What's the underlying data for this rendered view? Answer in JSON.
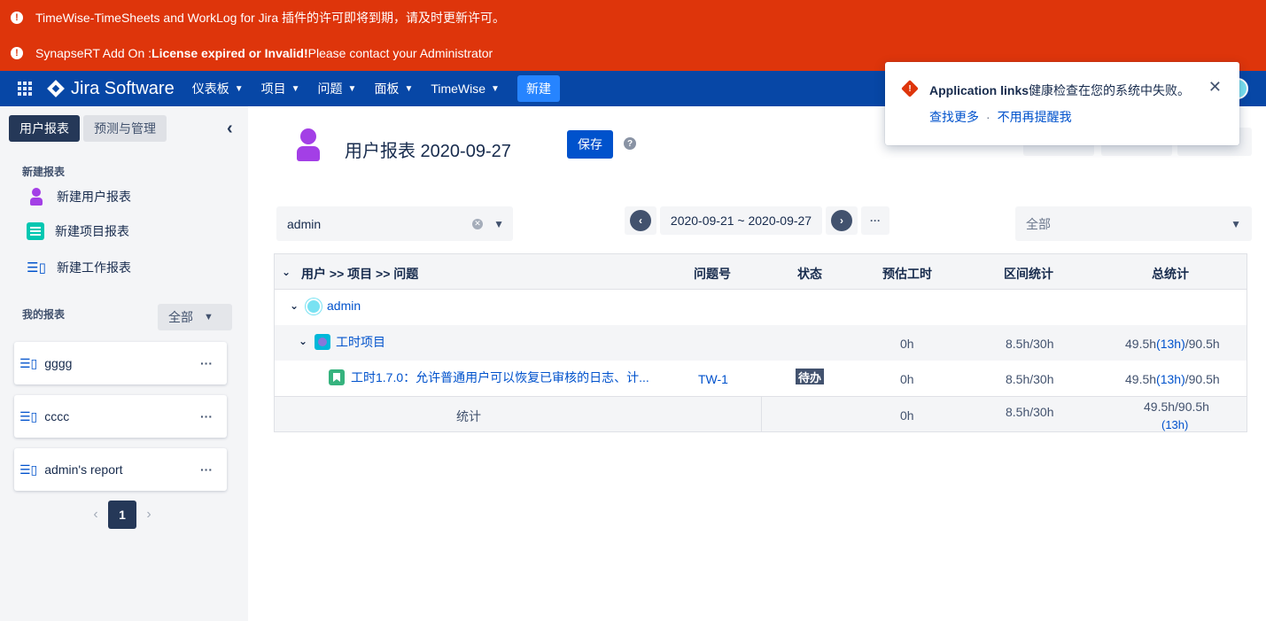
{
  "banners": [
    {
      "prefix": "TimeWise-TimeSheets and WorkLog for Jira 插件的许可即将到期，请及时更新许可。",
      "bold": "",
      "suffix": ""
    },
    {
      "prefix": "SynapseRT Add On : ",
      "bold": "License expired or Invalid!",
      "suffix": " Please contact your Administrator"
    }
  ],
  "topnav": {
    "logo": "Jira Software",
    "items": [
      "仪表板",
      "项目",
      "问题",
      "面板",
      "TimeWise"
    ],
    "create": "新建"
  },
  "sidebar": {
    "tabs": [
      "用户报表",
      "预测与管理"
    ],
    "new_title": "新建报表",
    "new_items": [
      "新建用户报表",
      "新建项目报表",
      "新建工作报表"
    ],
    "my_title": "我的报表",
    "filter": "全部",
    "reports": [
      "gggg",
      "cccc",
      "admin's report"
    ],
    "page": "1"
  },
  "main": {
    "title": "用户报表 2020-09-27",
    "save": "保存",
    "help": "?",
    "user_select": "admin",
    "date_range": "2020-09-21 ~ 2020-09-27",
    "date_more": "···",
    "scope": "全部"
  },
  "table": {
    "headers": [
      "用户 >> 项目 >> 问题",
      "问题号",
      "状态",
      "预估工时",
      "区间统计",
      "总统计"
    ],
    "user_row": {
      "name": "admin"
    },
    "project_row": {
      "name": "工时项目",
      "estimate": "0h",
      "range": "8.5h/30h",
      "total_a": "49.5h",
      "total_b": "(13h)",
      "total_c": "/90.5h"
    },
    "issue_row": {
      "name": "工时1.7.0：允许普通用户可以恢复已审核的日志、计...",
      "key": "TW-1",
      "status": "待办",
      "estimate": "0h",
      "range": "8.5h/30h",
      "total_a": "49.5h",
      "total_b": "(13h)",
      "total_c": "/90.5h"
    },
    "total_row": {
      "label": "统计",
      "estimate": "0h",
      "range": "8.5h/30h",
      "total_line1": "49.5h/90.5h",
      "total_line2": "(13h)"
    }
  },
  "flag": {
    "title_bold": "Application links",
    "title_rest": "健康检查在您的系统中失败。",
    "action1": "查找更多",
    "sep": "·",
    "action2": "不用再提醒我"
  },
  "colors": {
    "banner": "#de350b",
    "nav": "#0747a6",
    "primary": "#0052cc",
    "sidebar_active": "#253858"
  }
}
